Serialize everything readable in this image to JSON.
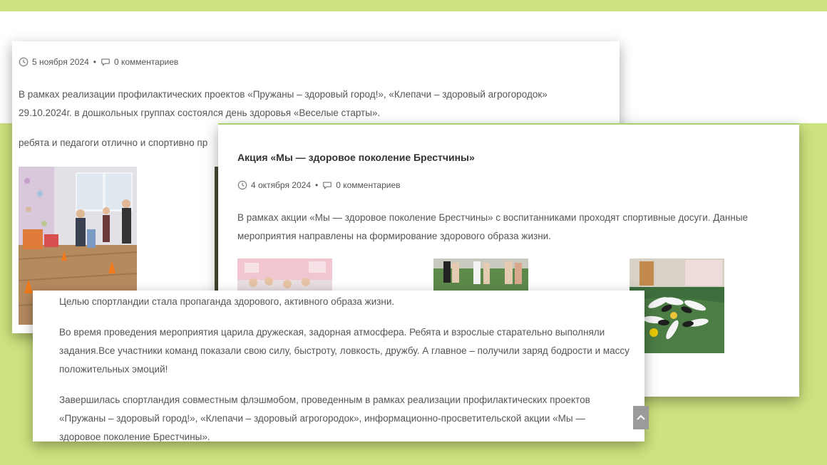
{
  "colors": {
    "background_band": "#cde37f",
    "card_accent": "#a6d36b"
  },
  "post1": {
    "date": "5 ноября 2024",
    "comments": "0 комментариев",
    "paragraph1": "В рамках реализации профилактических проектов «Пружаны – здоровый город!», «Клепачи – здоровый агрогородок» 29.10.2024г. в дошкольных группах состоялся день здоровья «Веселые старты».",
    "paragraph2": "ребята и педагоги отлично и спортивно пр"
  },
  "post2": {
    "title": "Акция «Мы — здоровое поколение Брестчины»",
    "date": "4 октября 2024",
    "comments": "0 комментариев",
    "paragraph": "В рамках акции «Мы — здоровое поколение Брестчины»  с воспитанниками проходят  спортивные досуги. Данные мероприятия направлены на формирование здорового образа жизни."
  },
  "post3": {
    "paragraph1": "Целью спортландии стала пропаганда здорового, активного образа жизни.",
    "paragraph2": "Во время проведения мероприятия царила дружеская, задорная атмосфера. Ребята и взрослые старательно выполняли задания.Все участники команд показали свою силу, быстроту, ловкость, дружбу. А главное – получили заряд бодрости и массу положительных эмоций!",
    "paragraph3": "Завершилась спортландия совместным флэшмобом, проведенным в рамках реализации профилактических проектов «Пружаны – здоровый город!», «Клепачи – здоровый агрогородок», информационно-просветительской акции «Мы — здоровое поколение Брестчины»."
  },
  "icons": {
    "date": "clock-icon",
    "comments": "comment-bubble-icon",
    "scroll_top": "chevron-up-icon"
  }
}
